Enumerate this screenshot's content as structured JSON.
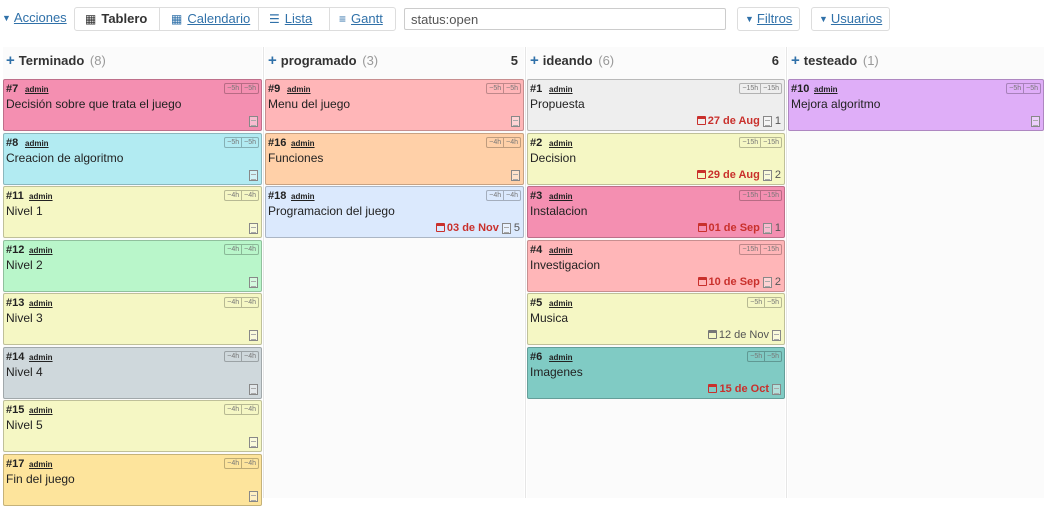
{
  "toolbar": {
    "actions_label": "Acciones",
    "views": {
      "board": "Tablero",
      "calendar": "Calendario",
      "list": "Lista",
      "gantt": "Gantt"
    },
    "search_value": "status:open",
    "filters_label": "Filtros",
    "users_label": "Usuarios"
  },
  "colors": {
    "pink": "#f48fb1",
    "cyan": "#b2ebf2",
    "yellow": "#f5f7c4",
    "green": "#b9f6ca",
    "grey": "#cfd8dc",
    "orange": "#ffd0a8",
    "blue": "#dbe9fd",
    "light_grey": "#eeeeee",
    "red": "#ffb6b8",
    "teal": "#80cbc4",
    "purple": "#dfaef8",
    "link": "#3071a9",
    "due_red": "#c9302c"
  },
  "columns": [
    {
      "title": "Terminado",
      "count": "(8)",
      "limit": "",
      "cards": [
        {
          "id": "#7",
          "user": "admin",
          "est": [
            "~5h",
            "~5h"
          ],
          "title": "Decisión sobre que trata el juego",
          "color": "#f48fb1",
          "due": "",
          "due_overdue": false,
          "comments": ""
        },
        {
          "id": "#8",
          "user": "admin",
          "est": [
            "~5h",
            "~5h"
          ],
          "title": "Creacion de algoritmo",
          "color": "#b2ebf2",
          "due": "",
          "due_overdue": false,
          "comments": ""
        },
        {
          "id": "#11",
          "user": "admin",
          "est": [
            "~4h",
            "~4h"
          ],
          "title": "Nivel 1",
          "color": "#f5f7c4",
          "due": "",
          "due_overdue": false,
          "comments": ""
        },
        {
          "id": "#12",
          "user": "admin",
          "est": [
            "~4h",
            "~4h"
          ],
          "title": "Nivel 2",
          "color": "#b9f6ca",
          "due": "",
          "due_overdue": false,
          "comments": ""
        },
        {
          "id": "#13",
          "user": "admin",
          "est": [
            "~4h",
            "~4h"
          ],
          "title": "Nivel 3",
          "color": "#f5f7c4",
          "due": "",
          "due_overdue": false,
          "comments": ""
        },
        {
          "id": "#14",
          "user": "admin",
          "est": [
            "~4h",
            "~4h"
          ],
          "title": "Nivel 4",
          "color": "#cfd8dc",
          "due": "",
          "due_overdue": false,
          "comments": ""
        },
        {
          "id": "#15",
          "user": "admin",
          "est": [
            "~4h",
            "~4h"
          ],
          "title": "Nivel 5",
          "color": "#f5f7c4",
          "due": "",
          "due_overdue": false,
          "comments": ""
        },
        {
          "id": "#17",
          "user": "admin",
          "est": [
            "~4h",
            "~4h"
          ],
          "title": "Fin del juego",
          "color": "#fde49c",
          "due": "",
          "due_overdue": false,
          "comments": ""
        }
      ]
    },
    {
      "title": "programado",
      "count": "(3)",
      "limit": "5",
      "cards": [
        {
          "id": "#9",
          "user": "admin",
          "est": [
            "~5h",
            "~5h"
          ],
          "title": "Menu del juego",
          "color": "#ffb6b8",
          "due": "",
          "due_overdue": false,
          "comments": ""
        },
        {
          "id": "#16",
          "user": "admin",
          "est": [
            "~4h",
            "~4h"
          ],
          "title": "Funciones",
          "color": "#ffd0a8",
          "due": "",
          "due_overdue": false,
          "comments": ""
        },
        {
          "id": "#18",
          "user": "admin",
          "est": [
            "~4h",
            "~4h"
          ],
          "title": "Programacion del juego",
          "color": "#dbe9fd",
          "due": "03 de Nov",
          "due_overdue": true,
          "comments": "5"
        }
      ]
    },
    {
      "title": "ideando",
      "count": "(6)",
      "limit": "6",
      "cards": [
        {
          "id": "#1",
          "user": "admin",
          "est": [
            "~15h",
            "~15h"
          ],
          "title": "Propuesta",
          "color": "#eeeeee",
          "due": "27 de Aug",
          "due_overdue": true,
          "comments": "1"
        },
        {
          "id": "#2",
          "user": "admin",
          "est": [
            "~15h",
            "~15h"
          ],
          "title": "Decision",
          "color": "#f5f7c4",
          "due": "29 de Aug",
          "due_overdue": true,
          "comments": "2"
        },
        {
          "id": "#3",
          "user": "admin",
          "est": [
            "~15h",
            "~15h"
          ],
          "title": "Instalacion",
          "color": "#f48fb1",
          "due": "01 de Sep",
          "due_overdue": true,
          "comments": "1"
        },
        {
          "id": "#4",
          "user": "admin",
          "est": [
            "~15h",
            "~15h"
          ],
          "title": "Investigacion",
          "color": "#ffb6b8",
          "due": "10 de Sep",
          "due_overdue": true,
          "comments": "2"
        },
        {
          "id": "#5",
          "user": "admin",
          "est": [
            "~5h",
            "~5h"
          ],
          "title": "Musica",
          "color": "#f5f7c4",
          "due": "12 de Nov",
          "due_overdue": false,
          "comments": ""
        },
        {
          "id": "#6",
          "user": "admin",
          "est": [
            "~5h",
            "~5h"
          ],
          "title": "Imagenes",
          "color": "#80cbc4",
          "due": "15 de Oct",
          "due_overdue": true,
          "comments": ""
        }
      ]
    },
    {
      "title": "testeado",
      "count": "(1)",
      "limit": "",
      "cards": [
        {
          "id": "#10",
          "user": "admin",
          "est": [
            "~5h",
            "~5h"
          ],
          "title": "Mejora algoritmo",
          "color": "#dfaef8",
          "due": "",
          "due_overdue": false,
          "comments": ""
        }
      ]
    }
  ]
}
